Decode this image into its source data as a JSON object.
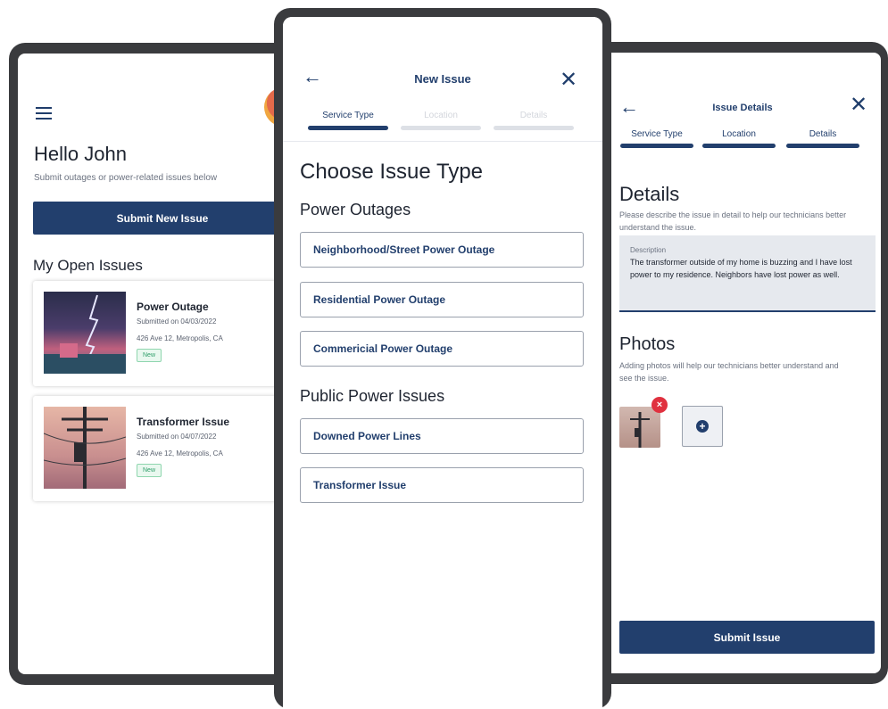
{
  "home": {
    "greeting": "Hello John",
    "subtitle": "Submit outages or power-related issues below",
    "submit_button": "Submit New Issue",
    "open_issues_title": "My Open Issues",
    "issues": [
      {
        "title": "Power Outage",
        "date": "Submitted on 04/03/2022",
        "address": "426 Ave 12, Metropolis, CA",
        "status": "New"
      },
      {
        "title": "Transformer Issue",
        "date": "Submitted on 04/07/2022",
        "address": "426 Ave 12, Metropolis, CA",
        "status": "New"
      }
    ]
  },
  "new_issue": {
    "title": "New Issue",
    "steps": [
      "Service Type",
      "Location",
      "Details"
    ],
    "choose_title": "Choose Issue Type",
    "power_outages": {
      "title": "Power Outages",
      "options": [
        "Neighborhood/Street Power Outage",
        "Residential Power Outage",
        "Commericial Power Outage"
      ]
    },
    "public_power": {
      "title": "Public Power Issues",
      "options": [
        "Downed Power Lines",
        "Transformer Issue"
      ]
    }
  },
  "issue_details": {
    "title": "Issue Details",
    "steps": [
      "Service Type",
      "Location",
      "Details"
    ],
    "details_title": "Details",
    "details_sub": "Please describe the issue in detail to help our technicians better understand the issue.",
    "description_label": "Description",
    "description_text": "The transformer outside of my home is buzzing and I have lost power to my residence. Neighbors have lost power as well.",
    "photos_title": "Photos",
    "photos_sub": "Adding photos will help our technicians better understand and see the issue.",
    "submit_button": "Submit Issue"
  },
  "colors": {
    "primary": "#223f6d",
    "inactive_step": "#dde0e6",
    "badge_green": "#2f9e6a",
    "remove_red": "#e0313f"
  },
  "icons": {
    "menu": "menu-icon",
    "back": "arrow-left-icon",
    "close": "close-icon",
    "remove": "x-icon",
    "add": "plus-icon"
  }
}
